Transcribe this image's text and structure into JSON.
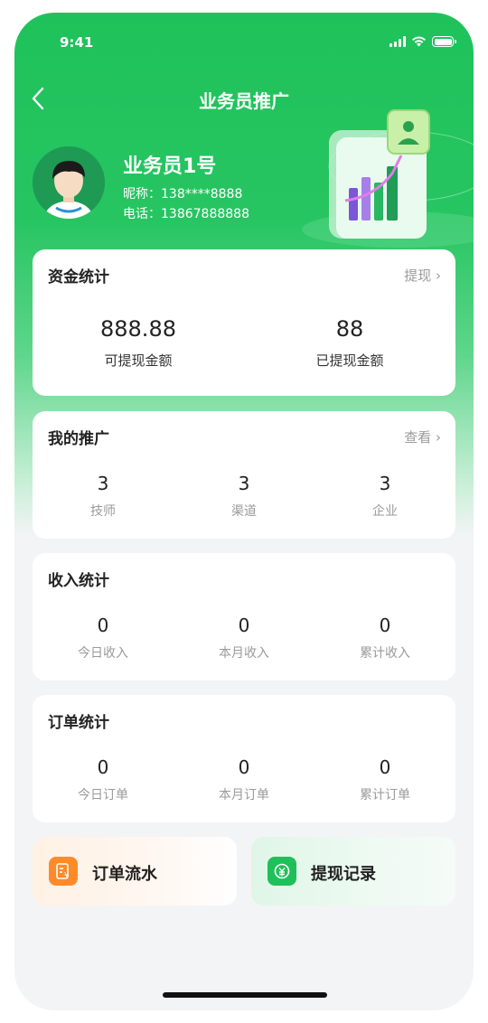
{
  "status": {
    "time": "9:41"
  },
  "nav": {
    "title": "业务员推广"
  },
  "profile": {
    "name": "业务员1号",
    "nickname": "昵称：138****8888",
    "phone": "电话：13867888888"
  },
  "fund": {
    "title": "资金统计",
    "link": "提现",
    "stats": [
      {
        "value": "888.88",
        "label": "可提现金额"
      },
      {
        "value": "88",
        "label": "已提现金额"
      }
    ]
  },
  "promo": {
    "title": "我的推广",
    "link": "查看",
    "stats": [
      {
        "value": "3",
        "label": "技师"
      },
      {
        "value": "3",
        "label": "渠道"
      },
      {
        "value": "3",
        "label": "企业"
      }
    ]
  },
  "income": {
    "title": "收入统计",
    "stats": [
      {
        "value": "0",
        "label": "今日收入"
      },
      {
        "value": "0",
        "label": "本月收入"
      },
      {
        "value": "0",
        "label": "累计收入"
      }
    ]
  },
  "orders": {
    "title": "订单统计",
    "stats": [
      {
        "value": "0",
        "label": "今日订单"
      },
      {
        "value": "0",
        "label": "本月订单"
      },
      {
        "value": "0",
        "label": "累计订单"
      }
    ]
  },
  "actions": {
    "order_flow": {
      "label": "订单流水",
      "icon": "receipt-icon",
      "color": "#ff8a2a"
    },
    "withdraw_records": {
      "label": "提现记录",
      "icon": "yuan-exchange-icon",
      "color": "#1fbf5a"
    }
  },
  "colors": {
    "brand": "#1fc25a",
    "orange": "#ff8a2a"
  }
}
